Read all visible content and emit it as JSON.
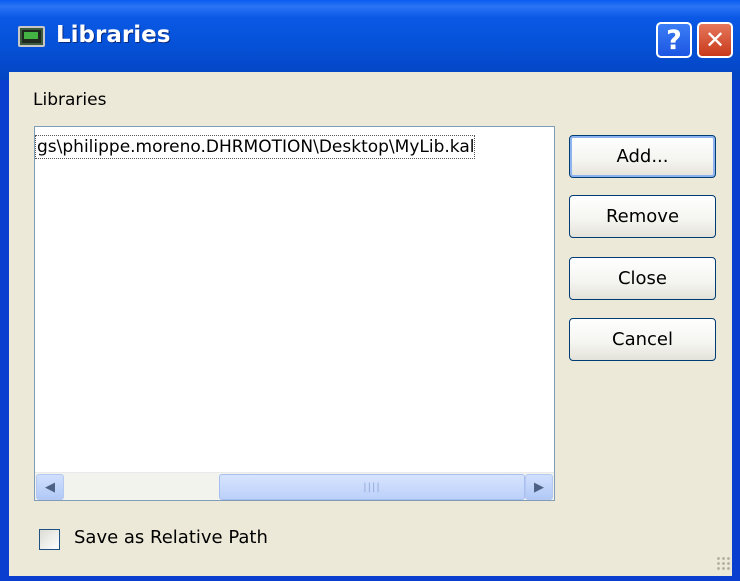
{
  "window": {
    "title": "Libraries",
    "title_icon": "library-window-icon",
    "help_glyph": "?",
    "close_glyph": "✕"
  },
  "group": {
    "label": "Libraries"
  },
  "list": {
    "items": [
      "gs\\philippe.moreno.DHRMOTION\\Desktop\\MyLib.kal"
    ]
  },
  "scrollbar": {
    "left_glyph": "◀",
    "right_glyph": "▶",
    "thumb_grip": "||||"
  },
  "buttons": {
    "add": "Add...",
    "remove": "Remove",
    "close": "Close",
    "cancel": "Cancel"
  },
  "checkbox": {
    "label": "Save as Relative Path",
    "checked": false
  }
}
